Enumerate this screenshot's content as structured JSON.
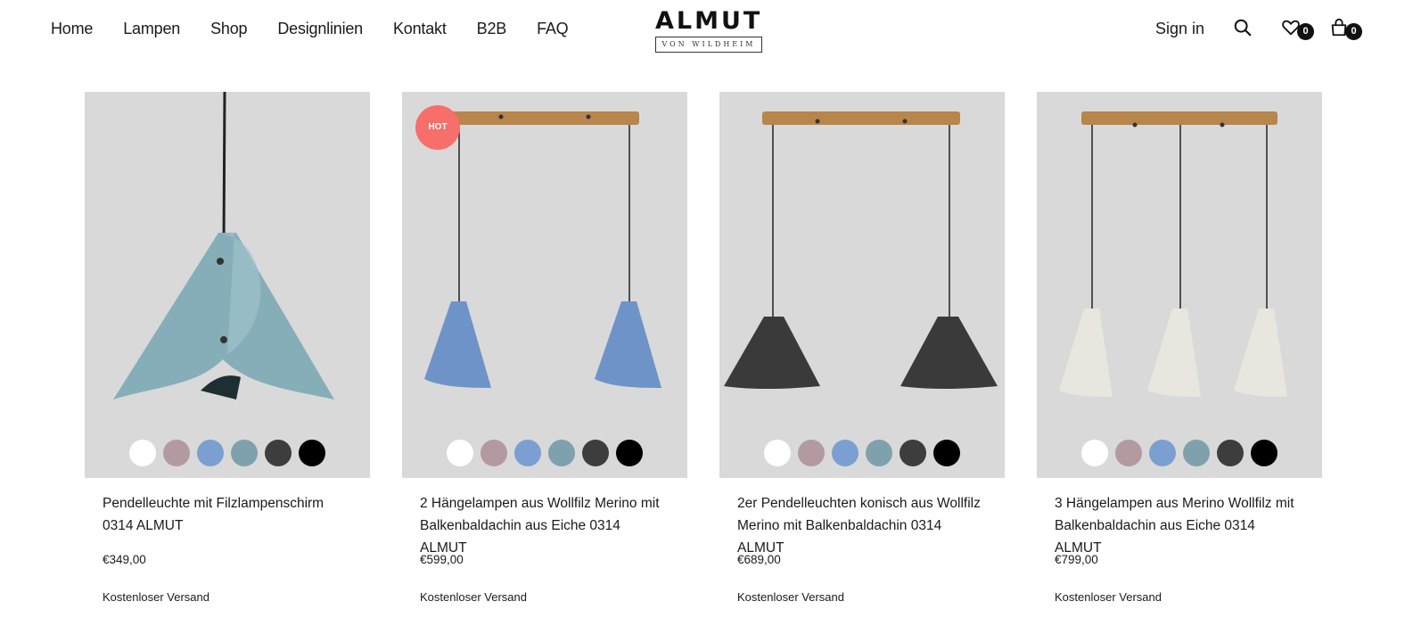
{
  "header": {
    "nav": [
      "Home",
      "Lampen",
      "Shop",
      "Designlinien",
      "Kontakt",
      "B2B",
      "FAQ"
    ],
    "logo_word": "ALMUT",
    "logo_sub": "VON WILDHEIM",
    "sign_in": "Sign in",
    "search_icon": "search-icon",
    "wishlist_icon": "heart-icon",
    "wishlist_count": "0",
    "cart_icon": "shopping-bag-icon",
    "cart_count": "0"
  },
  "swatch_colors": [
    "#ffffff",
    "#b39aa1",
    "#7b9fd0",
    "#7ea1ad",
    "#3d3d3d",
    "#000000"
  ],
  "products": [
    {
      "title": "Pendelleuchte mit Filzlampenschirm 0314 ALMUT",
      "price": "€349,00",
      "shipping": "Kostenloser Versand",
      "badge": "",
      "shade_color": "#86aeb9",
      "lamp_count": 1
    },
    {
      "title": "2 Hängelampen aus Wollfilz Merino mit Balkenbaldachin aus Eiche 0314 ALMUT",
      "price": "€599,00",
      "shipping": "Kostenloser Versand",
      "badge": "HOT",
      "shade_color": "#6e93c9",
      "lamp_count": 2
    },
    {
      "title": "2er Pendelleuchten konisch aus Wollfilz Merino mit Balkenbaldachin 0314 ALMUT",
      "price": "€689,00",
      "shipping": "Kostenloser Versand",
      "badge": "",
      "shade_color": "#3a3a3a",
      "lamp_count": 2
    },
    {
      "title": "3 Hängelampen aus Merino Wollfilz mit Balkenbaldachin aus Eiche 0314 ALMUT",
      "price": "€799,00",
      "shipping": "Kostenloser Versand",
      "badge": "",
      "shade_color": "#e9e6df",
      "lamp_count": 3
    }
  ]
}
